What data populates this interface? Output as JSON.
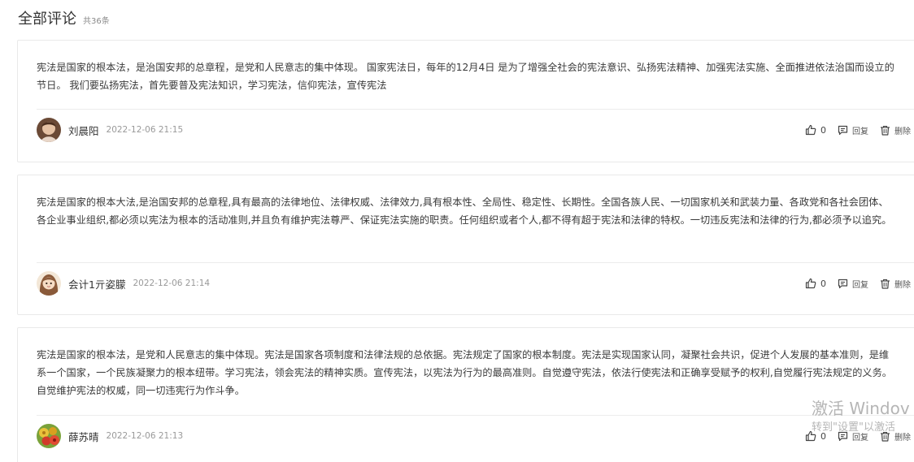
{
  "header": {
    "title": "全部评论",
    "count": "共36条"
  },
  "comments": [
    {
      "text": "宪法是国家的根本法，是治国安邦的总章程，是党和人民意志的集中体现。 国家宪法日，每年的12月4日 是为了增强全社会的宪法意识、弘扬宪法精神、加强宪法实施、全面推进依法治国而设立的节日。 我们要弘扬宪法，首先要普及宪法知识，学习宪法，信仰宪法，宣传宪法",
      "username": "刘晨阳",
      "time": "2022-12-06 21:15",
      "likes": "0",
      "reply_label": "回复",
      "delete_label": "删除",
      "avatar_icon": "user-avatar-photo"
    },
    {
      "text": "宪法是国家的根本大法,是治国安邦的总章程,具有最高的法律地位、法律权威、法律效力,具有根本性、全局性、稳定性、长期性。全国各族人民、一切国家机关和武装力量、各政党和各社会团体、各企业事业组织,都必须以宪法为根本的活动准则,并且负有维护宪法尊严、保证宪法实施的职责。任何组织或者个人,都不得有超于宪法和法律的特权。一切违反宪法和法律的行为,都必须予以追究。",
      "username": "会计1亓姿朦",
      "time": "2022-12-06 21:14",
      "likes": "0",
      "reply_label": "回复",
      "delete_label": "删除",
      "avatar_icon": "user-avatar-cartoon"
    },
    {
      "text": "宪法是国家的根本法，是党和人民意志的集中体现。宪法是国家各项制度和法律法规的总依据。宪法规定了国家的根本制度。宪法是实现国家认同，凝聚社会共识，促进个人发展的基本准则，是维系一个国家，一个民族凝聚力的根本纽带。学习宪法，领会宪法的精神实质。宣传宪法，以宪法为行为的最高准则。自觉遵守宪法，依法行使宪法和正确享受赋予的权利,自觉履行宪法规定的义务。自觉维护宪法的权威，同一切违宪行为作斗争。",
      "username": "薛苏晴",
      "time": "2022-12-06 21:13",
      "likes": "0",
      "reply_label": "回复",
      "delete_label": "删除",
      "avatar_icon": "user-avatar-flowers"
    }
  ],
  "watermark": {
    "line1": "激活 Windov",
    "line2": "转到\"设置\"以激活"
  },
  "colors": {
    "text": "#3a3a3a",
    "muted": "#999999",
    "border": "#e9e9e9"
  }
}
